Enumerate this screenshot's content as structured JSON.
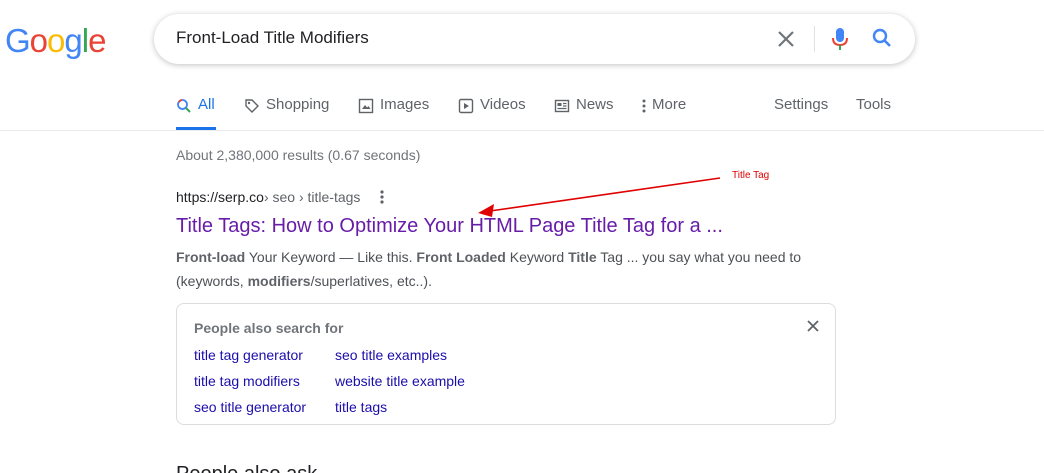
{
  "logo": {
    "letters": [
      "G",
      "o",
      "o",
      "g",
      "l",
      "e"
    ],
    "colors": [
      "#4285F4",
      "#EA4335",
      "#FBBC05",
      "#4285F4",
      "#34A853",
      "#EA4335"
    ]
  },
  "search": {
    "query": "Front-Load Title Modifiers"
  },
  "tabs": [
    {
      "label": "All",
      "icon": "search-icon",
      "active": true
    },
    {
      "label": "Shopping",
      "icon": "tag-icon"
    },
    {
      "label": "Images",
      "icon": "image-icon"
    },
    {
      "label": "Videos",
      "icon": "play-icon"
    },
    {
      "label": "News",
      "icon": "news-icon"
    },
    {
      "label": "More",
      "icon": "more-vert-icon"
    }
  ],
  "tools": {
    "settings": "Settings",
    "tools": "Tools"
  },
  "stats": "About 2,380,000 results (0.67 seconds)",
  "result": {
    "domain": "https://serp.co",
    "path": " › seo › title-tags",
    "title": "Title Tags: How to Optimize Your HTML Page Title Tag for a ...",
    "snippet": {
      "s1b": "Front-load",
      "s2": " Your Keyword — Like this. ",
      "s3b": "Front Loaded",
      "s4": " Keyword ",
      "s5b": "Title",
      "s6": " Tag ... you say what you need to (keywords, ",
      "s7b": "modifiers",
      "s8": "/superlatives, etc..)."
    }
  },
  "people_also_search": {
    "title": "People also search for",
    "links": [
      "title tag generator",
      "seo title examples",
      "title tag modifiers",
      "website title example",
      "seo title generator",
      "title tags"
    ]
  },
  "next_heading": "People also ask",
  "annotation": {
    "label": "Title Tag",
    "color": "#e00000"
  },
  "colors": {
    "link_visited": "#681da8",
    "link": "#1a0dab",
    "accent": "#1a73e8"
  }
}
